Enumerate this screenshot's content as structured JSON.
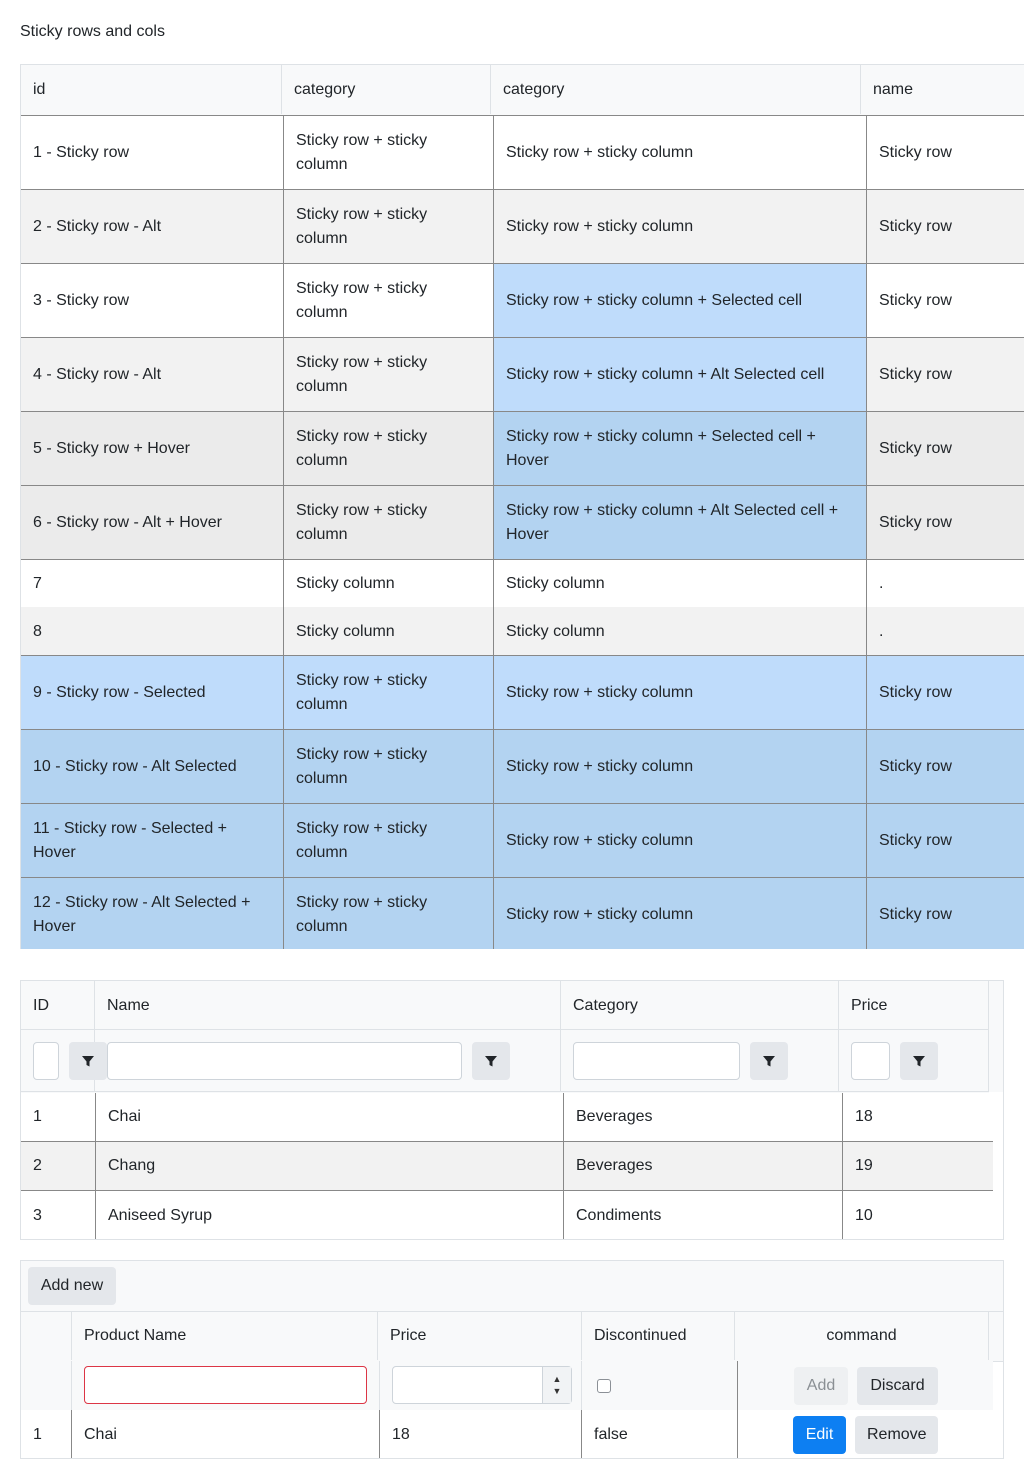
{
  "caption": "Sticky rows and cols",
  "grid1": {
    "headers": [
      "id",
      "category",
      "category",
      "name"
    ],
    "rows": [
      {
        "id": "1 - Sticky row",
        "c1": "Sticky row + sticky column",
        "c2": "Sticky row + sticky column",
        "name": "Sticky row"
      },
      {
        "id": "2 - Sticky row - Alt",
        "c1": "Sticky row + sticky column",
        "c2": "Sticky row + sticky column",
        "name": "Sticky row"
      },
      {
        "id": "3 - Sticky row",
        "c1": "Sticky row + sticky column",
        "c2": "Sticky row + sticky column + Selected cell",
        "name": "Sticky row"
      },
      {
        "id": "4 - Sticky row - Alt",
        "c1": "Sticky row + sticky column",
        "c2": "Sticky row + sticky column + Alt Selected cell",
        "name": "Sticky row"
      },
      {
        "id": "5 - Sticky row + Hover",
        "c1": "Sticky row + sticky column",
        "c2": "Sticky row + sticky column + Selected cell + Hover",
        "name": "Sticky row"
      },
      {
        "id": "6 - Sticky row - Alt + Hover",
        "c1": "Sticky row + sticky column",
        "c2": "Sticky row + sticky column + Alt Selected cell + Hover",
        "name": "Sticky row"
      },
      {
        "id": "7",
        "c1": "Sticky column",
        "c2": "Sticky column",
        "name": "."
      },
      {
        "id": "8",
        "c1": "Sticky column",
        "c2": "Sticky column",
        "name": "."
      },
      {
        "id": "9 - Sticky row - Selected",
        "c1": "Sticky row + sticky column",
        "c2": "Sticky row + sticky column",
        "name": "Sticky row"
      },
      {
        "id": "10 - Sticky row - Alt Selected",
        "c1": "Sticky row + sticky column",
        "c2": "Sticky row + sticky column",
        "name": "Sticky row"
      },
      {
        "id": "11 - Sticky row - Selected + Hover",
        "c1": "Sticky row + sticky column",
        "c2": "Sticky row + sticky column",
        "name": "Sticky row"
      },
      {
        "id": "12 - Sticky row - Alt Selected + Hover",
        "c1": "Sticky row + sticky column",
        "c2": "Sticky row + sticky column",
        "name": "Sticky row"
      }
    ]
  },
  "grid2": {
    "headers": [
      "ID",
      "Name",
      "Category",
      "Price"
    ],
    "filter_icon": "filter-icon",
    "rows": [
      {
        "id": "1",
        "name": "Chai",
        "category": "Beverages",
        "price": "18"
      },
      {
        "id": "2",
        "name": "Chang",
        "category": "Beverages",
        "price": "19"
      },
      {
        "id": "3",
        "name": "Aniseed Syrup",
        "category": "Condiments",
        "price": "10"
      }
    ]
  },
  "grid3": {
    "add_new_label": "Add new",
    "headers": [
      "",
      "Product Name",
      "Price",
      "Discontinued",
      "command"
    ],
    "edit_row": {
      "add_label": "Add",
      "discard_label": "Discard"
    },
    "rows": [
      {
        "id": "1",
        "name": "Chai",
        "price": "18",
        "discontinued": "false",
        "edit_label": "Edit",
        "remove_label": "Remove"
      }
    ]
  },
  "colors": {
    "primary": "#0d7ff2",
    "selected": "#bfdcfb",
    "selected_hover": "#b3d3f1",
    "alt": "#f2f2f2",
    "invalid": "#dc3545"
  }
}
